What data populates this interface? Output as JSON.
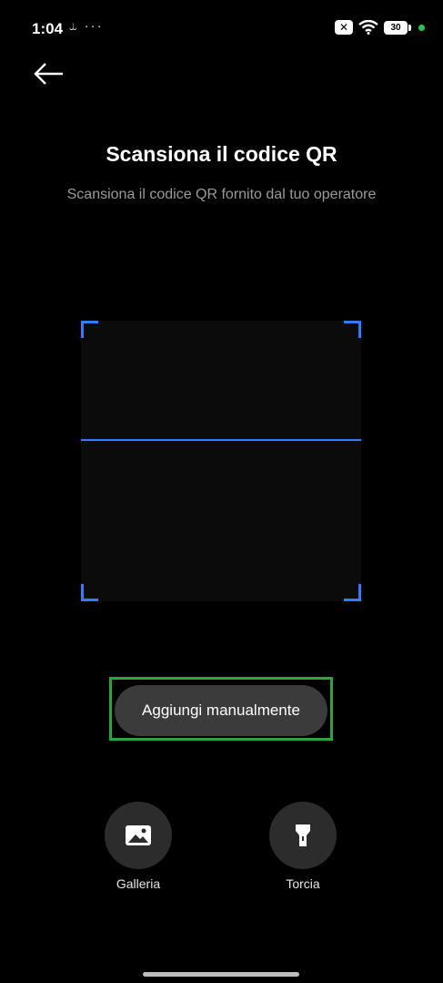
{
  "status_bar": {
    "time": "1:04",
    "left_icons": "⥿ ···",
    "battery_level": "30"
  },
  "header": {
    "title": "Scansiona il codice QR",
    "subtitle": "Scansiona il codice QR fornito dal tuo operatore"
  },
  "scanner": {
    "frame_color": "#2f7cff"
  },
  "actions": {
    "manual_label": "Aggiungi manualmente",
    "gallery_label": "Galleria",
    "torch_label": "Torcia"
  },
  "colors": {
    "background": "#000000",
    "button": "#3b3b3b",
    "highlight": "#2aa53b",
    "accent": "#2f7cff"
  },
  "icons": [
    "back-arrow-icon",
    "gallery-icon",
    "flashlight-icon",
    "wifi-icon",
    "battery-icon"
  ]
}
